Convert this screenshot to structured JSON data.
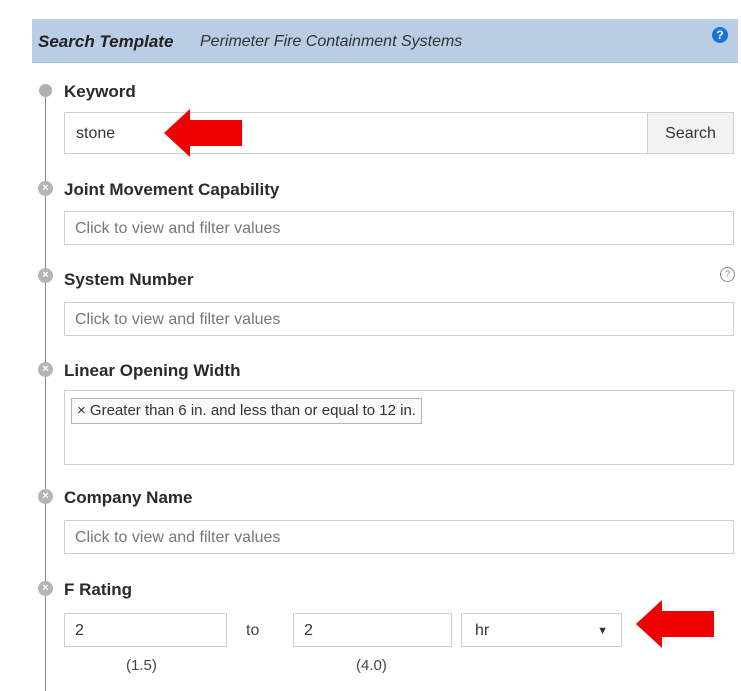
{
  "header": {
    "title_bold": "Search Template",
    "title_sub": "Perimeter Fire Containment Systems",
    "help_icon": "question-circle-icon",
    "accent_color": "#1a73d9"
  },
  "keyword": {
    "label": "Keyword",
    "value": "stone",
    "search_button": "Search"
  },
  "filters": {
    "joint_movement": {
      "label": "Joint Movement Capability",
      "placeholder": "Click to view and filter values"
    },
    "system_number": {
      "label": "System Number",
      "placeholder": "Click to view and filter values",
      "help": "?"
    },
    "linear_opening": {
      "label": "Linear Opening Width",
      "tag": "× Greater than 6 in. and less than or equal to 12 in."
    },
    "company_name": {
      "label": "Company Name",
      "placeholder": "Click to view and filter values"
    },
    "f_rating": {
      "label": "F Rating",
      "from_value": "2",
      "to_text": "to",
      "to_value": "2",
      "unit": "hr",
      "from_hint": "(1.5)",
      "to_hint": "(4.0)"
    }
  },
  "annotations": {
    "arrow_color": "#ee0000"
  }
}
